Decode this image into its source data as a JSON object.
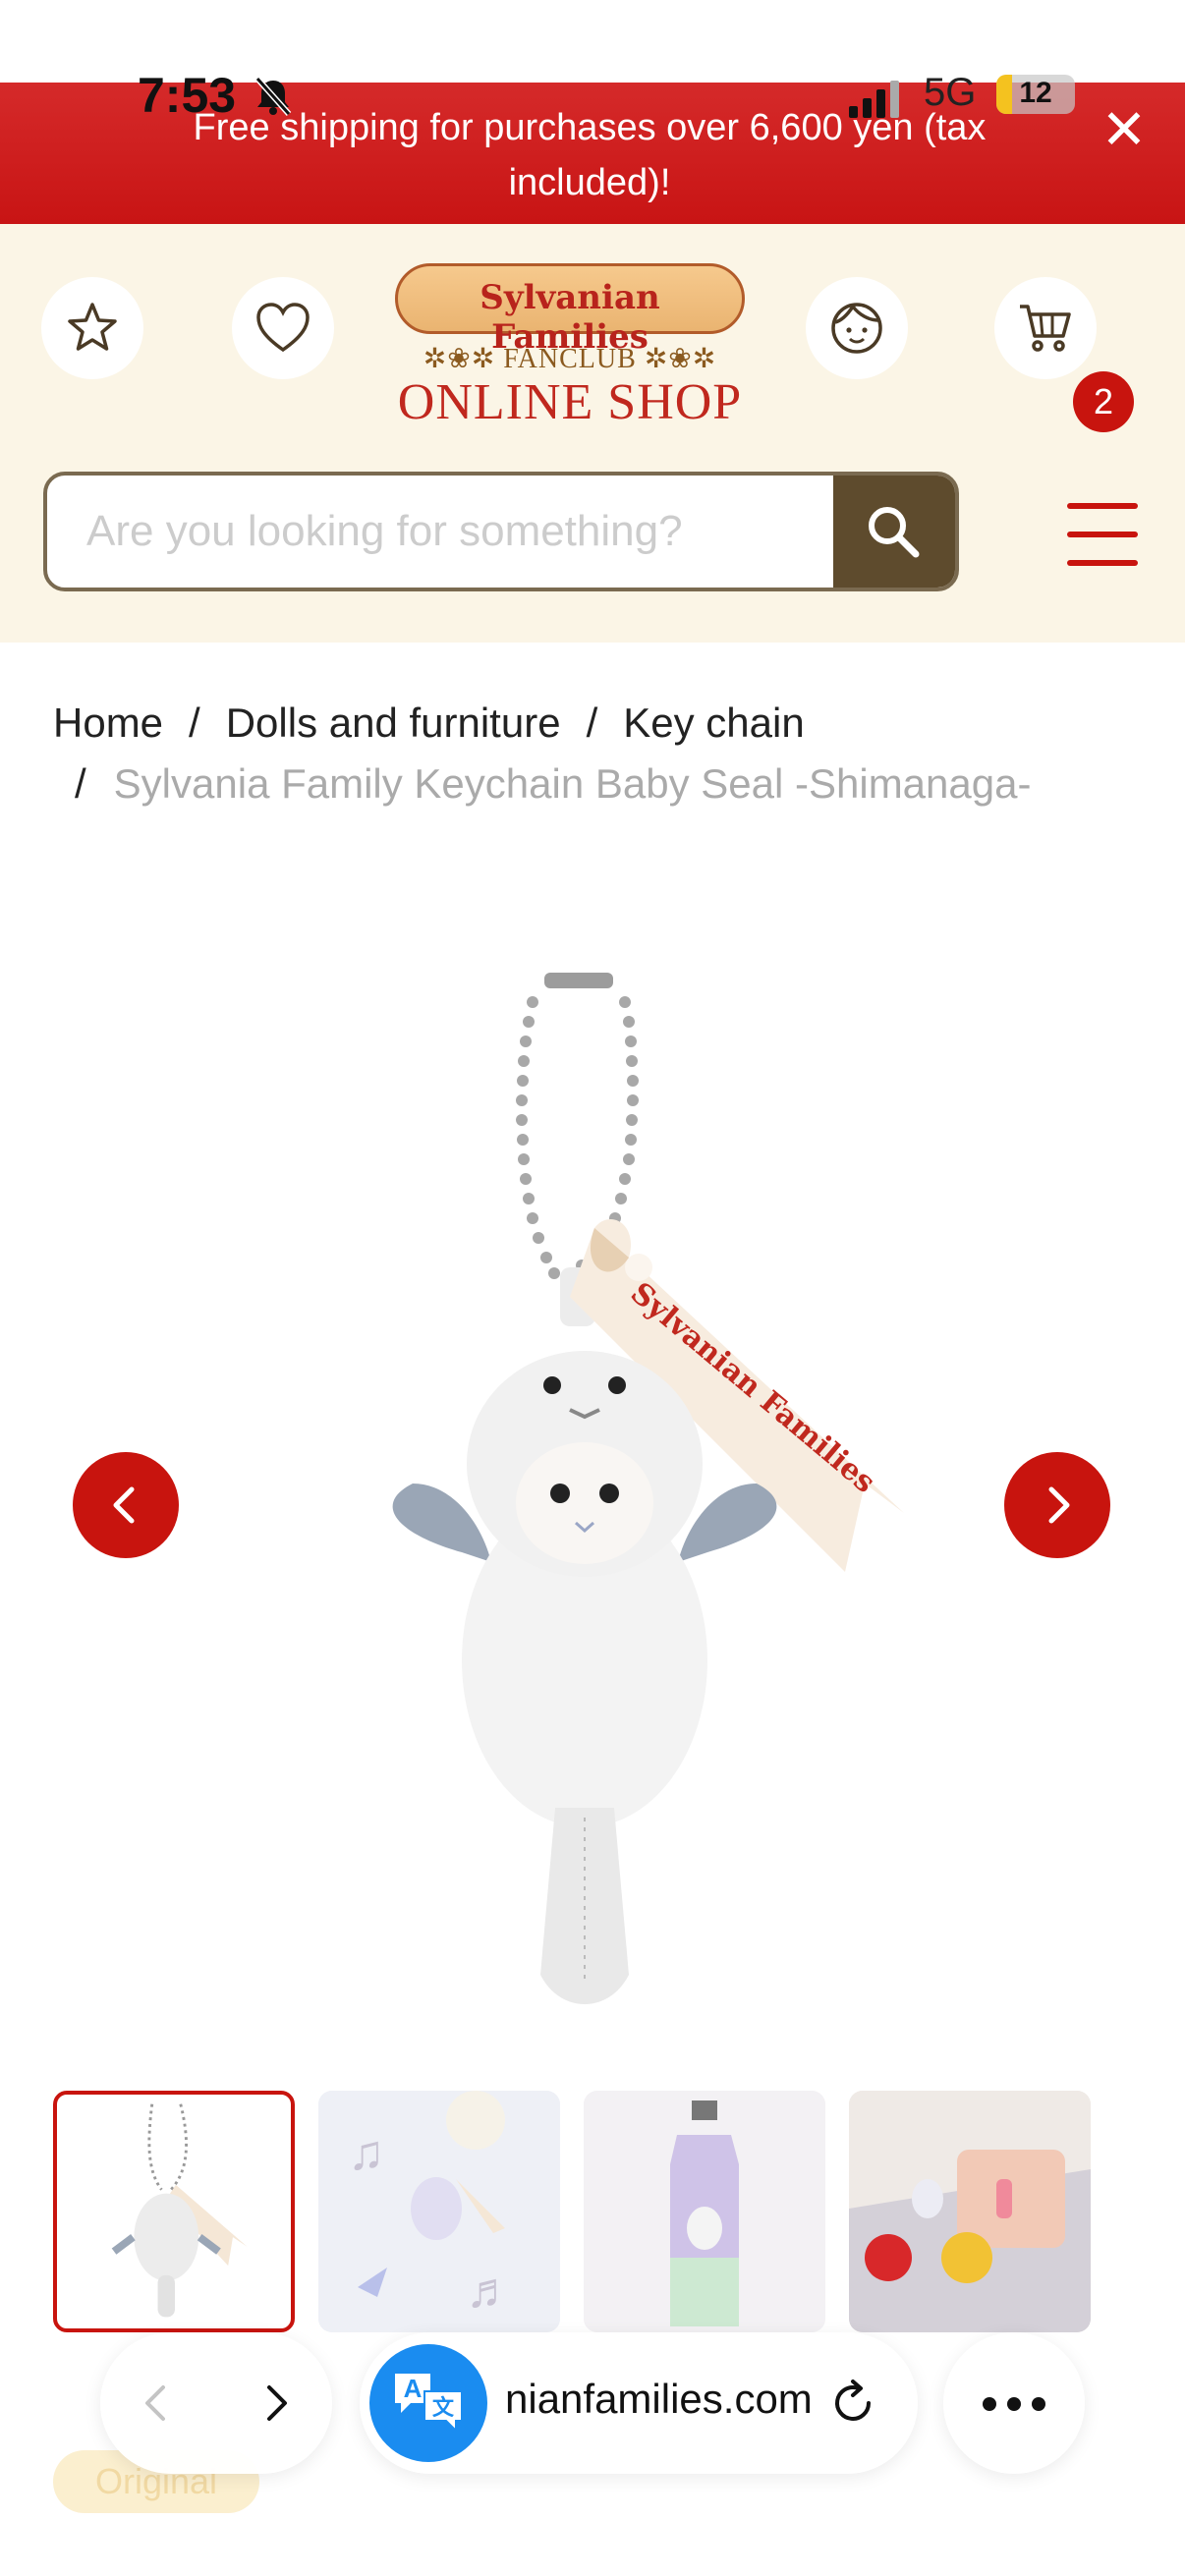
{
  "status_bar": {
    "time": "7:53",
    "network": "5G",
    "battery": "12"
  },
  "banner": {
    "text": "Free shipping for purchases over 6,600 yen (tax included)!"
  },
  "header": {
    "logo": {
      "brand": "Sylvanian Families",
      "fanclub": "FANCLUB",
      "shop": "ONLINE SHOP"
    },
    "cart_count": "2",
    "icons": [
      "star-icon",
      "heart-icon",
      "user-face-icon",
      "cart-icon",
      "hamburger-menu-icon"
    ]
  },
  "search": {
    "placeholder": "Are you looking for something?",
    "value": ""
  },
  "breadcrumb": {
    "items": [
      "Home",
      "Dolls and furniture",
      "Key chain"
    ],
    "current": "Sylvania Family Keychain Baby Seal -Shimanaga-",
    "separator": "/"
  },
  "gallery": {
    "ribbon_text": "Sylvanian Families",
    "thumbnail_count": 4,
    "active_index": 0
  },
  "product": {
    "badge": "Original"
  },
  "browser": {
    "url": "nianfamilies.com"
  },
  "colors": {
    "brand_red": "#c8140e",
    "header_bg": "#fbf5e6",
    "search_btn": "#5e4b2d",
    "translate_blue": "#1a8cf0"
  }
}
